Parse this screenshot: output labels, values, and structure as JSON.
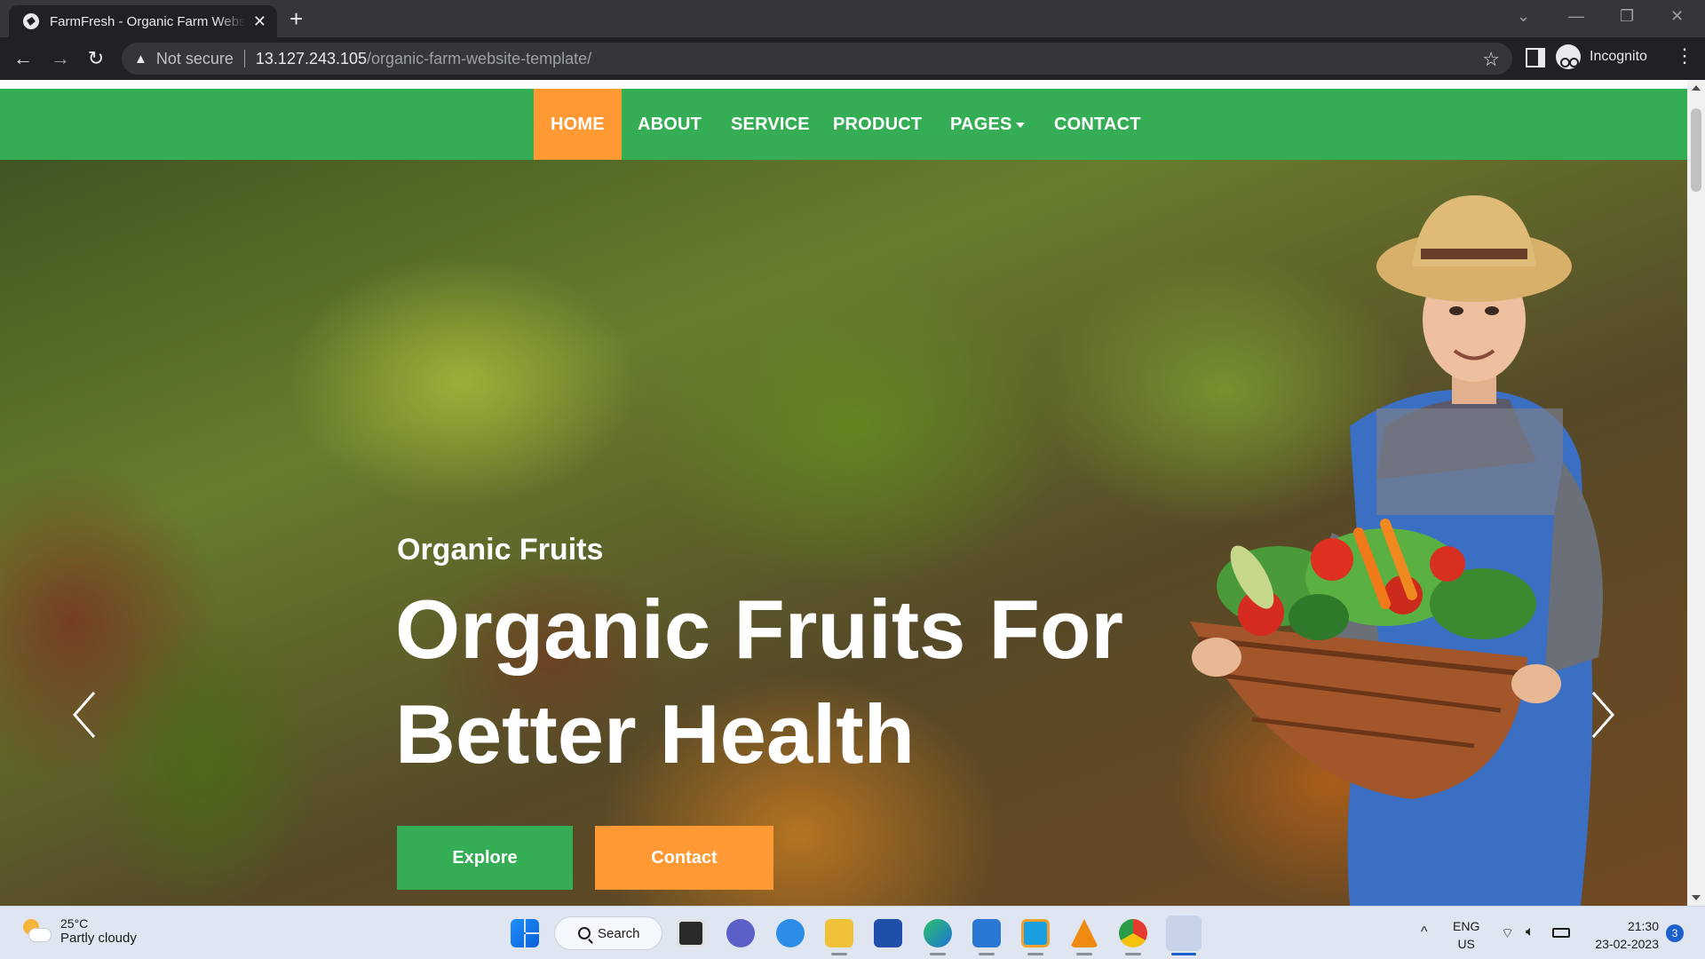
{
  "browser": {
    "tab_title": "FarmFresh - Organic Farm Website Template",
    "new_tab_symbol": "+",
    "security_label": "Not secure",
    "url_host": "13.127.243.105",
    "url_path": "/organic-farm-website-template/",
    "profile_label": "Incognito"
  },
  "navbar": {
    "items": [
      {
        "label": "HOME",
        "active": true
      },
      {
        "label": "ABOUT"
      },
      {
        "label": "SERVICE"
      },
      {
        "label": "PRODUCT"
      },
      {
        "label": "PAGES"
      },
      {
        "label": "CONTACT"
      }
    ]
  },
  "hero": {
    "subtitle": "Organic Fruits",
    "title": "Organic Fruits For Better Health",
    "buttons": {
      "explore": "Explore",
      "contact": "Contact"
    }
  },
  "taskbar": {
    "weather_temp": "25°C",
    "weather_desc": "Partly cloudy",
    "search_label": "Search",
    "lang_line1": "ENG",
    "lang_line2": "US",
    "time": "21:30",
    "date": "23-02-2023",
    "notification_count": "3"
  },
  "colors": {
    "brand_green": "#34ad54",
    "accent_orange": "#ff9933"
  }
}
